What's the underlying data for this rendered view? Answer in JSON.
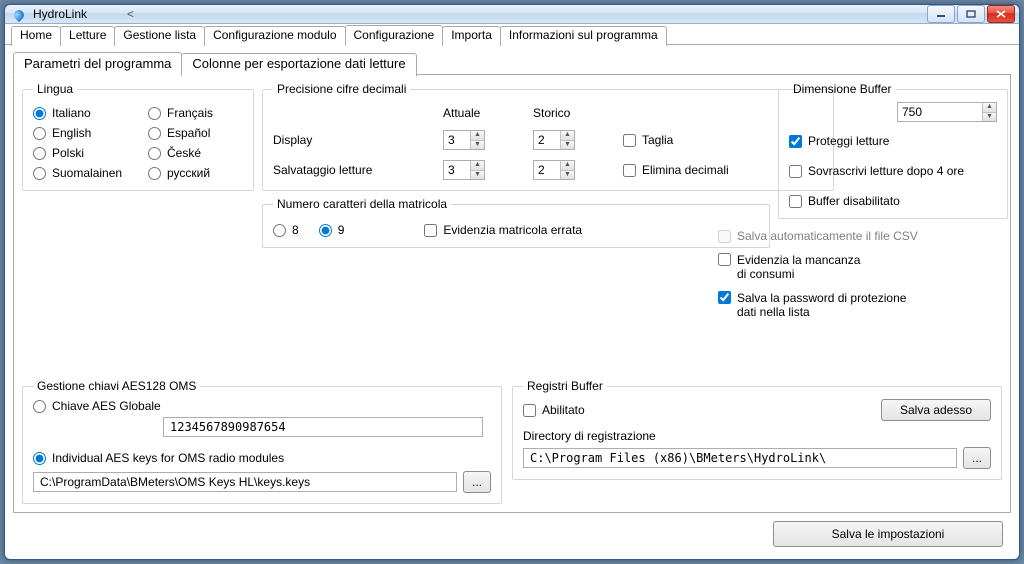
{
  "window": {
    "title": "HydroLink"
  },
  "tabs": {
    "outer": [
      "Home",
      "Letture",
      "Gestione lista",
      "Configurazione modulo",
      "Configurazione",
      "Importa",
      "Informazioni sul programma"
    ],
    "outer_active": 4,
    "inner": [
      "Parametri del programma",
      "Colonne per esportazione dati letture"
    ],
    "inner_active": 0
  },
  "group": {
    "lingua": "Lingua",
    "precisione": "Precisione cifre decimali",
    "matricola": "Numero caratteri della matricola",
    "buffer": "Dimensione Buffer",
    "aes": "Gestione chiavi AES128 OMS",
    "registri": "Registri Buffer"
  },
  "lang": {
    "options": [
      "Italiano",
      "Français",
      "English",
      "Español",
      "Polski",
      "České",
      "Suomalainen",
      "русский"
    ],
    "selected": "Italiano"
  },
  "prec": {
    "col_attuale": "Attuale",
    "col_storico": "Storico",
    "row_display": "Display",
    "row_salv": "Salvataggio letture",
    "display_att": "3",
    "display_sto": "2",
    "salv_att": "3",
    "salv_sto": "2",
    "taglia": "Taglia",
    "elimina": "Elimina decimali"
  },
  "matric": {
    "opt8": "8",
    "opt9": "9",
    "selected": "9",
    "evidenzia": "Evidenzia matricola errata"
  },
  "buffer": {
    "value": "750",
    "proteggi": "Proteggi letture",
    "sovrascrivi": "Sovrascrivi letture dopo 4 ore",
    "disabilitato": "Buffer disabilitato"
  },
  "right_checks": {
    "salva_csv": "Salva automaticamente il file CSV",
    "evidenzia_line1": "Evidenzia la mancanza",
    "evidenzia_line2": "di consumi",
    "salva_pwd_line1": "Salva la password di protezione",
    "salva_pwd_line2": "dati nella lista"
  },
  "aes": {
    "chiave_globale": "Chiave AES Globale",
    "individual": "Individual AES keys for OMS radio modules",
    "global_key_value": "1234567890987654",
    "keys_path": "C:\\ProgramData\\BMeters\\OMS Keys HL\\keys.keys"
  },
  "registri": {
    "abilitato": "Abilitato",
    "salva_adesso": "Salva adesso",
    "dir_label": "Directory di registrazione",
    "dir_value": "C:\\Program Files (x86)\\BMeters\\HydroLink\\"
  },
  "footer": {
    "salva_imp": "Salva le impostazioni"
  },
  "browse": "..."
}
